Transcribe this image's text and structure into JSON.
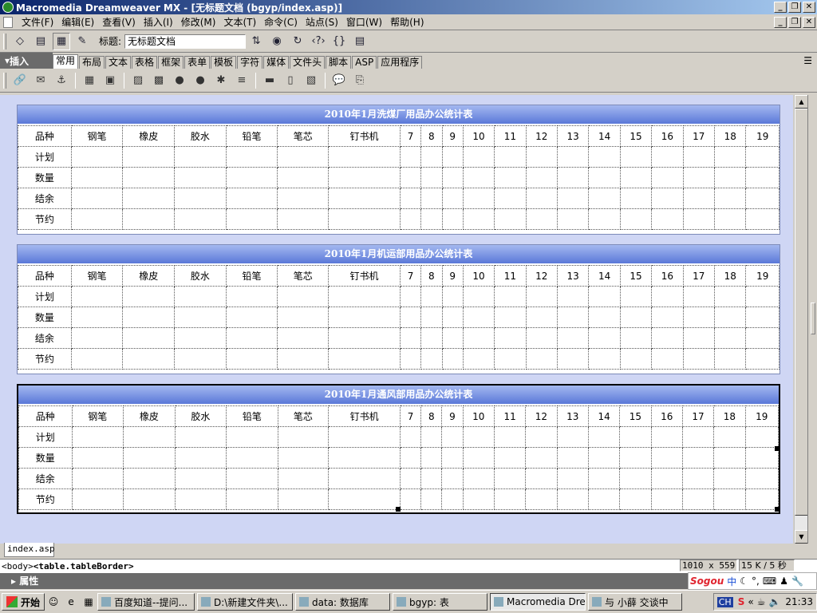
{
  "window": {
    "title": "Macromedia Dreamweaver MX - [无标题文档 (bgyp/index.asp)]"
  },
  "menu": {
    "items": [
      "文件(F)",
      "编辑(E)",
      "查看(V)",
      "插入(I)",
      "修改(M)",
      "文本(T)",
      "命令(C)",
      "站点(S)",
      "窗口(W)",
      "帮助(H)"
    ]
  },
  "doc_toolbar": {
    "title_label": "标题:",
    "title_value": "无标题文档"
  },
  "insert_bar": {
    "label": "插入",
    "tabs": [
      "常用",
      "布局",
      "文本",
      "表格",
      "框架",
      "表单",
      "模板",
      "字符",
      "媒体",
      "文件头",
      "脚本",
      "ASP",
      "应用程序"
    ],
    "active_tab": "常用"
  },
  "tables": [
    {
      "title": "2010年1月洗煤厂用品办公统计表",
      "header": [
        "品种",
        "钢笔",
        "橡皮",
        "胶水",
        "铅笔",
        "笔芯",
        "钉书机",
        "7",
        "8",
        "9",
        "10",
        "11",
        "12",
        "13",
        "14",
        "15",
        "16",
        "17",
        "18",
        "19"
      ],
      "rows": [
        "计划",
        "数量",
        "结余",
        "节约"
      ]
    },
    {
      "title": "2010年1月机运部用品办公统计表",
      "header": [
        "品种",
        "钢笔",
        "橡皮",
        "胶水",
        "铅笔",
        "笔芯",
        "钉书机",
        "7",
        "8",
        "9",
        "10",
        "11",
        "12",
        "13",
        "14",
        "15",
        "16",
        "17",
        "18",
        "19"
      ],
      "rows": [
        "计划",
        "数量",
        "结余",
        "节约"
      ]
    },
    {
      "title": "2010年1月通风部用品办公统计表",
      "header": [
        "品种",
        "钢笔",
        "橡皮",
        "胶水",
        "铅笔",
        "笔芯",
        "钉书机",
        "7",
        "8",
        "9",
        "10",
        "11",
        "12",
        "13",
        "14",
        "15",
        "16",
        "17",
        "18",
        "19"
      ],
      "rows": [
        "计划",
        "数量",
        "结余",
        "节约"
      ]
    }
  ],
  "chart_data": [
    {
      "type": "table",
      "title": "2010年1月洗煤厂用品办公统计表",
      "columns": [
        "品种",
        "钢笔",
        "橡皮",
        "胶水",
        "铅笔",
        "笔芯",
        "钉书机",
        "7",
        "8",
        "9",
        "10",
        "11",
        "12",
        "13",
        "14",
        "15",
        "16",
        "17",
        "18",
        "19"
      ],
      "rows": [
        [
          "计划"
        ],
        [
          "数量"
        ],
        [
          "结余"
        ],
        [
          "节约"
        ]
      ]
    },
    {
      "type": "table",
      "title": "2010年1月机运部用品办公统计表",
      "columns": [
        "品种",
        "钢笔",
        "橡皮",
        "胶水",
        "铅笔",
        "笔芯",
        "钉书机",
        "7",
        "8",
        "9",
        "10",
        "11",
        "12",
        "13",
        "14",
        "15",
        "16",
        "17",
        "18",
        "19"
      ],
      "rows": [
        [
          "计划"
        ],
        [
          "数量"
        ],
        [
          "结余"
        ],
        [
          "节约"
        ]
      ]
    },
    {
      "type": "table",
      "title": "2010年1月通风部用品办公统计表",
      "columns": [
        "品种",
        "钢笔",
        "橡皮",
        "胶水",
        "铅笔",
        "笔芯",
        "钉书机",
        "7",
        "8",
        "9",
        "10",
        "11",
        "12",
        "13",
        "14",
        "15",
        "16",
        "17",
        "18",
        "19"
      ],
      "rows": [
        [
          "计划"
        ],
        [
          "数量"
        ],
        [
          "结余"
        ],
        [
          "节约"
        ]
      ]
    }
  ],
  "doc_tab": "index.asp",
  "tag_selector": {
    "body": "<body>",
    "table": "<table.tableBorder>"
  },
  "status": {
    "window_size": "1010 x 559",
    "download": "15 K / 5 秒"
  },
  "properties_label": "属性",
  "ime": {
    "logo": "Sogou",
    "mode": "中"
  },
  "taskbar": {
    "start": "开始",
    "tasks": [
      "百度知道--提问...",
      "D:\\新建文件夹\\...",
      "data: 数据库",
      "bgyp: 表",
      "Macromedia Dre...",
      "与 小薛 交谈中"
    ],
    "active_task": 4,
    "lang": "CH",
    "clock": "21:33"
  }
}
